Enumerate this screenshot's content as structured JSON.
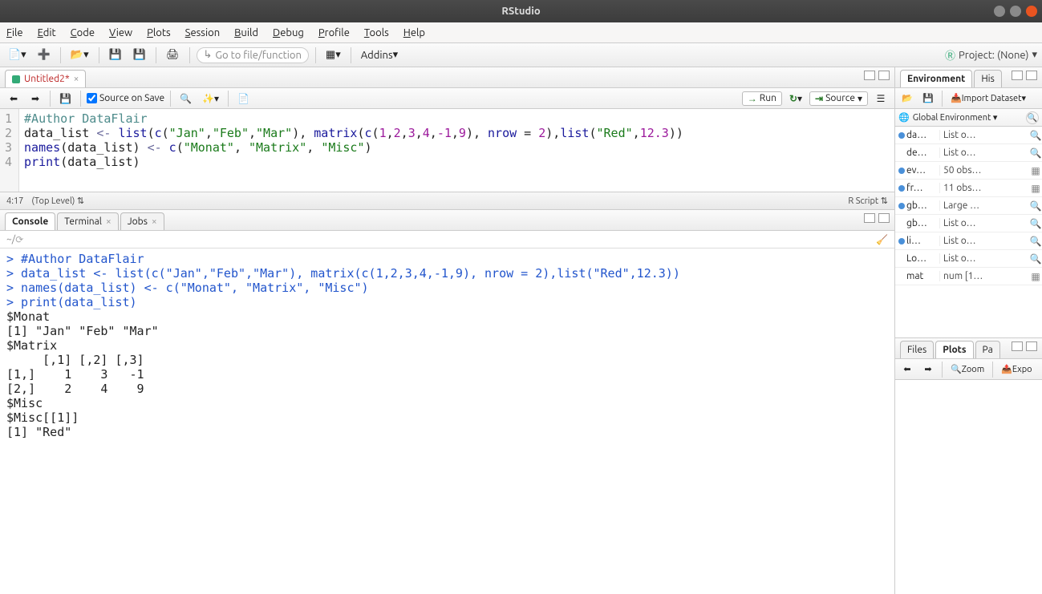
{
  "title": "RStudio",
  "menu": [
    "File",
    "Edit",
    "Code",
    "View",
    "Plots",
    "Session",
    "Build",
    "Debug",
    "Profile",
    "Tools",
    "Help"
  ],
  "maintool": {
    "gotofile": "Go to file/function",
    "addins": "Addins",
    "project_label": "Project: (None)"
  },
  "source": {
    "tab_title": "Untitled2*",
    "source_on_save": "Source on Save",
    "run": "Run",
    "source_btn": "Source",
    "status_pos": "4:17",
    "status_scope": "(Top Level)",
    "status_type": "R Script",
    "lines": [
      {
        "n": "1",
        "seg": [
          [
            "comment",
            "#Author DataFlair"
          ]
        ]
      },
      {
        "n": "2",
        "seg": [
          [
            "plain",
            "data_list "
          ],
          [
            "op",
            "<-"
          ],
          [
            "plain",
            " "
          ],
          [
            "kw",
            "list"
          ],
          [
            "plain",
            "("
          ],
          [
            "kw",
            "c"
          ],
          [
            "plain",
            "("
          ],
          [
            "str",
            "\"Jan\""
          ],
          [
            "plain",
            ","
          ],
          [
            "str",
            "\"Feb\""
          ],
          [
            "plain",
            ","
          ],
          [
            "str",
            "\"Mar\""
          ],
          [
            "plain",
            "), "
          ],
          [
            "kw",
            "matrix"
          ],
          [
            "plain",
            "("
          ],
          [
            "kw",
            "c"
          ],
          [
            "plain",
            "("
          ],
          [
            "num",
            "1"
          ],
          [
            "plain",
            ","
          ],
          [
            "num",
            "2"
          ],
          [
            "plain",
            ","
          ],
          [
            "num",
            "3"
          ],
          [
            "plain",
            ","
          ],
          [
            "num",
            "4"
          ],
          [
            "plain",
            ","
          ],
          [
            "num",
            "-1"
          ],
          [
            "plain",
            ","
          ],
          [
            "num",
            "9"
          ],
          [
            "plain",
            "), "
          ],
          [
            "arg",
            "nrow"
          ],
          [
            "plain",
            " = "
          ],
          [
            "num",
            "2"
          ],
          [
            "plain",
            "),"
          ],
          [
            "kw",
            "list"
          ],
          [
            "plain",
            "("
          ],
          [
            "str",
            "\"Red\""
          ],
          [
            "plain",
            ","
          ],
          [
            "num",
            "12.3"
          ],
          [
            "plain",
            "))"
          ]
        ]
      },
      {
        "n": "3",
        "seg": [
          [
            "kw",
            "names"
          ],
          [
            "plain",
            "(data_list) "
          ],
          [
            "op",
            "<-"
          ],
          [
            "plain",
            " "
          ],
          [
            "kw",
            "c"
          ],
          [
            "plain",
            "("
          ],
          [
            "str",
            "\"Monat\""
          ],
          [
            "plain",
            ", "
          ],
          [
            "str",
            "\"Matrix\""
          ],
          [
            "plain",
            ", "
          ],
          [
            "str",
            "\"Misc\""
          ],
          [
            "plain",
            ")"
          ]
        ]
      },
      {
        "n": "4",
        "seg": [
          [
            "kw",
            "print"
          ],
          [
            "plain",
            "(data_list)"
          ]
        ]
      }
    ]
  },
  "console": {
    "tabs": [
      "Console",
      "Terminal",
      "Jobs"
    ],
    "path": "~/",
    "lines": [
      {
        "t": "cmd",
        "v": "#Author DataFlair"
      },
      {
        "t": "cmd",
        "v": "data_list <- list(c(\"Jan\",\"Feb\",\"Mar\"), matrix(c(1,2,3,4,-1,9), nrow = 2),list(\"Red\",12.3))"
      },
      {
        "t": "cmd",
        "v": "names(data_list) <- c(\"Monat\", \"Matrix\", \"Misc\")"
      },
      {
        "t": "cmd",
        "v": "print(data_list)"
      },
      {
        "t": "out",
        "v": "$Monat"
      },
      {
        "t": "out",
        "v": "[1] \"Jan\" \"Feb\" \"Mar\""
      },
      {
        "t": "out",
        "v": ""
      },
      {
        "t": "out",
        "v": "$Matrix"
      },
      {
        "t": "out",
        "v": "     [,1] [,2] [,3]"
      },
      {
        "t": "out",
        "v": "[1,]    1    3   -1"
      },
      {
        "t": "out",
        "v": "[2,]    2    4    9"
      },
      {
        "t": "out",
        "v": ""
      },
      {
        "t": "out",
        "v": "$Misc"
      },
      {
        "t": "out",
        "v": "$Misc[[1]]"
      },
      {
        "t": "out",
        "v": "[1] \"Red\""
      },
      {
        "t": "out",
        "v": ""
      }
    ]
  },
  "env": {
    "tabs": [
      "Environment",
      "His"
    ],
    "import": "Import Dataset",
    "scope": "Global Environment",
    "rows": [
      {
        "dot": true,
        "name": "da…",
        "val": "List o…",
        "ico": "🔍"
      },
      {
        "dot": false,
        "name": "de…",
        "val": "List o…",
        "ico": "🔍"
      },
      {
        "dot": true,
        "name": "ev…",
        "val": "50 obs…",
        "ico": "▦"
      },
      {
        "dot": true,
        "name": "fr…",
        "val": "11 obs…",
        "ico": "▦"
      },
      {
        "dot": true,
        "name": "gb…",
        "val": "Large …",
        "ico": "🔍"
      },
      {
        "dot": false,
        "name": "gb…",
        "val": "List o…",
        "ico": "🔍"
      },
      {
        "dot": true,
        "name": "li…",
        "val": "List o…",
        "ico": "🔍"
      },
      {
        "dot": false,
        "name": "Lo…",
        "val": "List o…",
        "ico": "🔍"
      },
      {
        "dot": false,
        "name": "mat",
        "val": "num [1…",
        "ico": "▦"
      }
    ]
  },
  "files": {
    "tabs": [
      "Files",
      "Plots",
      "Pa"
    ],
    "zoom": "Zoom",
    "export": "Expo"
  }
}
